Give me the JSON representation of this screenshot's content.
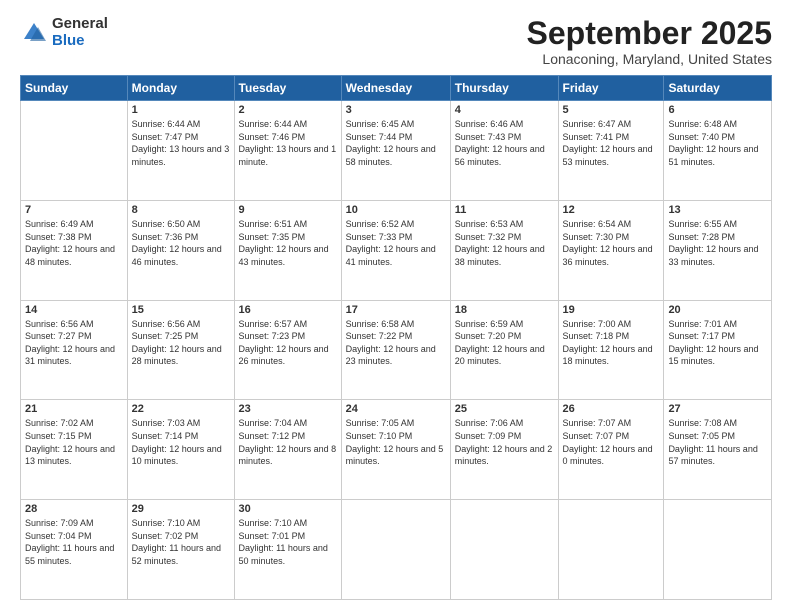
{
  "logo": {
    "general": "General",
    "blue": "Blue"
  },
  "header": {
    "month": "September 2025",
    "location": "Lonaconing, Maryland, United States"
  },
  "days_of_week": [
    "Sunday",
    "Monday",
    "Tuesday",
    "Wednesday",
    "Thursday",
    "Friday",
    "Saturday"
  ],
  "weeks": [
    [
      {
        "day": "",
        "sunrise": "",
        "sunset": "",
        "daylight": ""
      },
      {
        "day": "1",
        "sunrise": "Sunrise: 6:44 AM",
        "sunset": "Sunset: 7:47 PM",
        "daylight": "Daylight: 13 hours and 3 minutes."
      },
      {
        "day": "2",
        "sunrise": "Sunrise: 6:44 AM",
        "sunset": "Sunset: 7:46 PM",
        "daylight": "Daylight: 13 hours and 1 minute."
      },
      {
        "day": "3",
        "sunrise": "Sunrise: 6:45 AM",
        "sunset": "Sunset: 7:44 PM",
        "daylight": "Daylight: 12 hours and 58 minutes."
      },
      {
        "day": "4",
        "sunrise": "Sunrise: 6:46 AM",
        "sunset": "Sunset: 7:43 PM",
        "daylight": "Daylight: 12 hours and 56 minutes."
      },
      {
        "day": "5",
        "sunrise": "Sunrise: 6:47 AM",
        "sunset": "Sunset: 7:41 PM",
        "daylight": "Daylight: 12 hours and 53 minutes."
      },
      {
        "day": "6",
        "sunrise": "Sunrise: 6:48 AM",
        "sunset": "Sunset: 7:40 PM",
        "daylight": "Daylight: 12 hours and 51 minutes."
      }
    ],
    [
      {
        "day": "7",
        "sunrise": "Sunrise: 6:49 AM",
        "sunset": "Sunset: 7:38 PM",
        "daylight": "Daylight: 12 hours and 48 minutes."
      },
      {
        "day": "8",
        "sunrise": "Sunrise: 6:50 AM",
        "sunset": "Sunset: 7:36 PM",
        "daylight": "Daylight: 12 hours and 46 minutes."
      },
      {
        "day": "9",
        "sunrise": "Sunrise: 6:51 AM",
        "sunset": "Sunset: 7:35 PM",
        "daylight": "Daylight: 12 hours and 43 minutes."
      },
      {
        "day": "10",
        "sunrise": "Sunrise: 6:52 AM",
        "sunset": "Sunset: 7:33 PM",
        "daylight": "Daylight: 12 hours and 41 minutes."
      },
      {
        "day": "11",
        "sunrise": "Sunrise: 6:53 AM",
        "sunset": "Sunset: 7:32 PM",
        "daylight": "Daylight: 12 hours and 38 minutes."
      },
      {
        "day": "12",
        "sunrise": "Sunrise: 6:54 AM",
        "sunset": "Sunset: 7:30 PM",
        "daylight": "Daylight: 12 hours and 36 minutes."
      },
      {
        "day": "13",
        "sunrise": "Sunrise: 6:55 AM",
        "sunset": "Sunset: 7:28 PM",
        "daylight": "Daylight: 12 hours and 33 minutes."
      }
    ],
    [
      {
        "day": "14",
        "sunrise": "Sunrise: 6:56 AM",
        "sunset": "Sunset: 7:27 PM",
        "daylight": "Daylight: 12 hours and 31 minutes."
      },
      {
        "day": "15",
        "sunrise": "Sunrise: 6:56 AM",
        "sunset": "Sunset: 7:25 PM",
        "daylight": "Daylight: 12 hours and 28 minutes."
      },
      {
        "day": "16",
        "sunrise": "Sunrise: 6:57 AM",
        "sunset": "Sunset: 7:23 PM",
        "daylight": "Daylight: 12 hours and 26 minutes."
      },
      {
        "day": "17",
        "sunrise": "Sunrise: 6:58 AM",
        "sunset": "Sunset: 7:22 PM",
        "daylight": "Daylight: 12 hours and 23 minutes."
      },
      {
        "day": "18",
        "sunrise": "Sunrise: 6:59 AM",
        "sunset": "Sunset: 7:20 PM",
        "daylight": "Daylight: 12 hours and 20 minutes."
      },
      {
        "day": "19",
        "sunrise": "Sunrise: 7:00 AM",
        "sunset": "Sunset: 7:18 PM",
        "daylight": "Daylight: 12 hours and 18 minutes."
      },
      {
        "day": "20",
        "sunrise": "Sunrise: 7:01 AM",
        "sunset": "Sunset: 7:17 PM",
        "daylight": "Daylight: 12 hours and 15 minutes."
      }
    ],
    [
      {
        "day": "21",
        "sunrise": "Sunrise: 7:02 AM",
        "sunset": "Sunset: 7:15 PM",
        "daylight": "Daylight: 12 hours and 13 minutes."
      },
      {
        "day": "22",
        "sunrise": "Sunrise: 7:03 AM",
        "sunset": "Sunset: 7:14 PM",
        "daylight": "Daylight: 12 hours and 10 minutes."
      },
      {
        "day": "23",
        "sunrise": "Sunrise: 7:04 AM",
        "sunset": "Sunset: 7:12 PM",
        "daylight": "Daylight: 12 hours and 8 minutes."
      },
      {
        "day": "24",
        "sunrise": "Sunrise: 7:05 AM",
        "sunset": "Sunset: 7:10 PM",
        "daylight": "Daylight: 12 hours and 5 minutes."
      },
      {
        "day": "25",
        "sunrise": "Sunrise: 7:06 AM",
        "sunset": "Sunset: 7:09 PM",
        "daylight": "Daylight: 12 hours and 2 minutes."
      },
      {
        "day": "26",
        "sunrise": "Sunrise: 7:07 AM",
        "sunset": "Sunset: 7:07 PM",
        "daylight": "Daylight: 12 hours and 0 minutes."
      },
      {
        "day": "27",
        "sunrise": "Sunrise: 7:08 AM",
        "sunset": "Sunset: 7:05 PM",
        "daylight": "Daylight: 11 hours and 57 minutes."
      }
    ],
    [
      {
        "day": "28",
        "sunrise": "Sunrise: 7:09 AM",
        "sunset": "Sunset: 7:04 PM",
        "daylight": "Daylight: 11 hours and 55 minutes."
      },
      {
        "day": "29",
        "sunrise": "Sunrise: 7:10 AM",
        "sunset": "Sunset: 7:02 PM",
        "daylight": "Daylight: 11 hours and 52 minutes."
      },
      {
        "day": "30",
        "sunrise": "Sunrise: 7:10 AM",
        "sunset": "Sunset: 7:01 PM",
        "daylight": "Daylight: 11 hours and 50 minutes."
      },
      {
        "day": "",
        "sunrise": "",
        "sunset": "",
        "daylight": ""
      },
      {
        "day": "",
        "sunrise": "",
        "sunset": "",
        "daylight": ""
      },
      {
        "day": "",
        "sunrise": "",
        "sunset": "",
        "daylight": ""
      },
      {
        "day": "",
        "sunrise": "",
        "sunset": "",
        "daylight": ""
      }
    ]
  ]
}
